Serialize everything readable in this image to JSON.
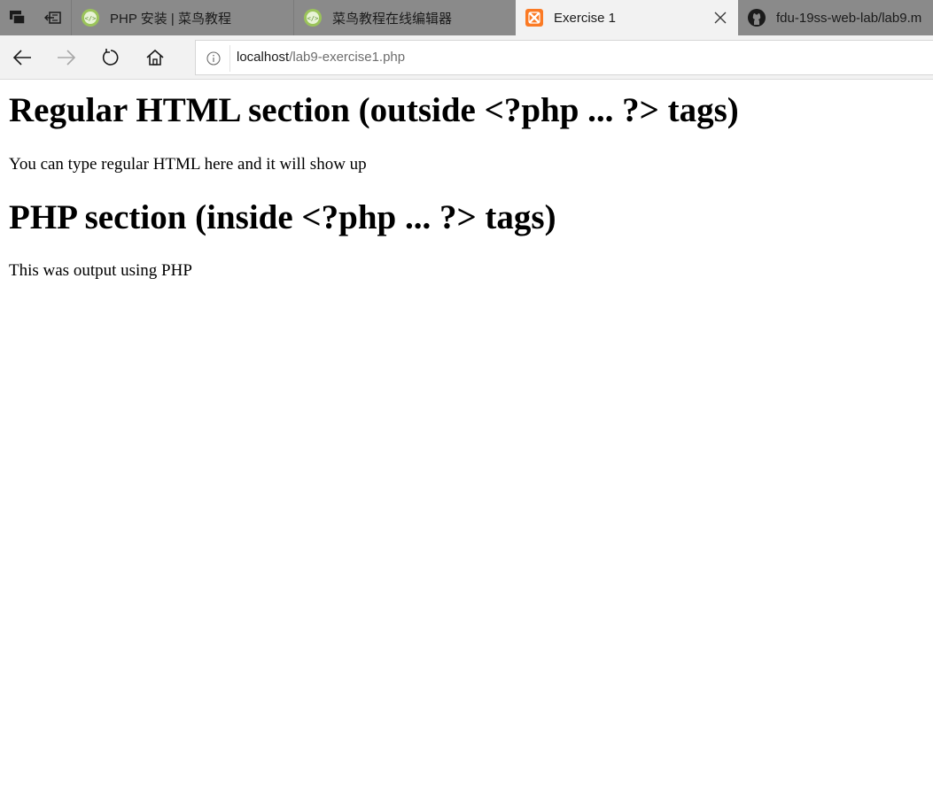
{
  "browser": {
    "tabs": [
      {
        "title": "PHP 安装 | 菜鸟教程",
        "favicon": "runoob-icon",
        "active": false
      },
      {
        "title": "菜鸟教程在线编辑器",
        "favicon": "runoob-icon",
        "active": false
      },
      {
        "title": "Exercise 1",
        "favicon": "xampp-icon",
        "active": true
      },
      {
        "title": "fdu-19ss-web-lab/lab9.m",
        "favicon": "github-icon",
        "active": false
      }
    ],
    "address": {
      "host": "localhost",
      "path": "/lab9-exercise1.php"
    },
    "colors": {
      "tab_strip": "#8a8a8a",
      "active_tab": "#f2f2f2",
      "toolbar": "#f2f2f2",
      "xampp_orange": "#fb7a24"
    }
  },
  "page": {
    "heading1": "Regular HTML section (outside <?php ... ?> tags)",
    "paragraph1": "You can type regular HTML here and it will show up",
    "heading2": "PHP section (inside <?php ... ?> tags)",
    "paragraph2": "This was output using PHP"
  }
}
